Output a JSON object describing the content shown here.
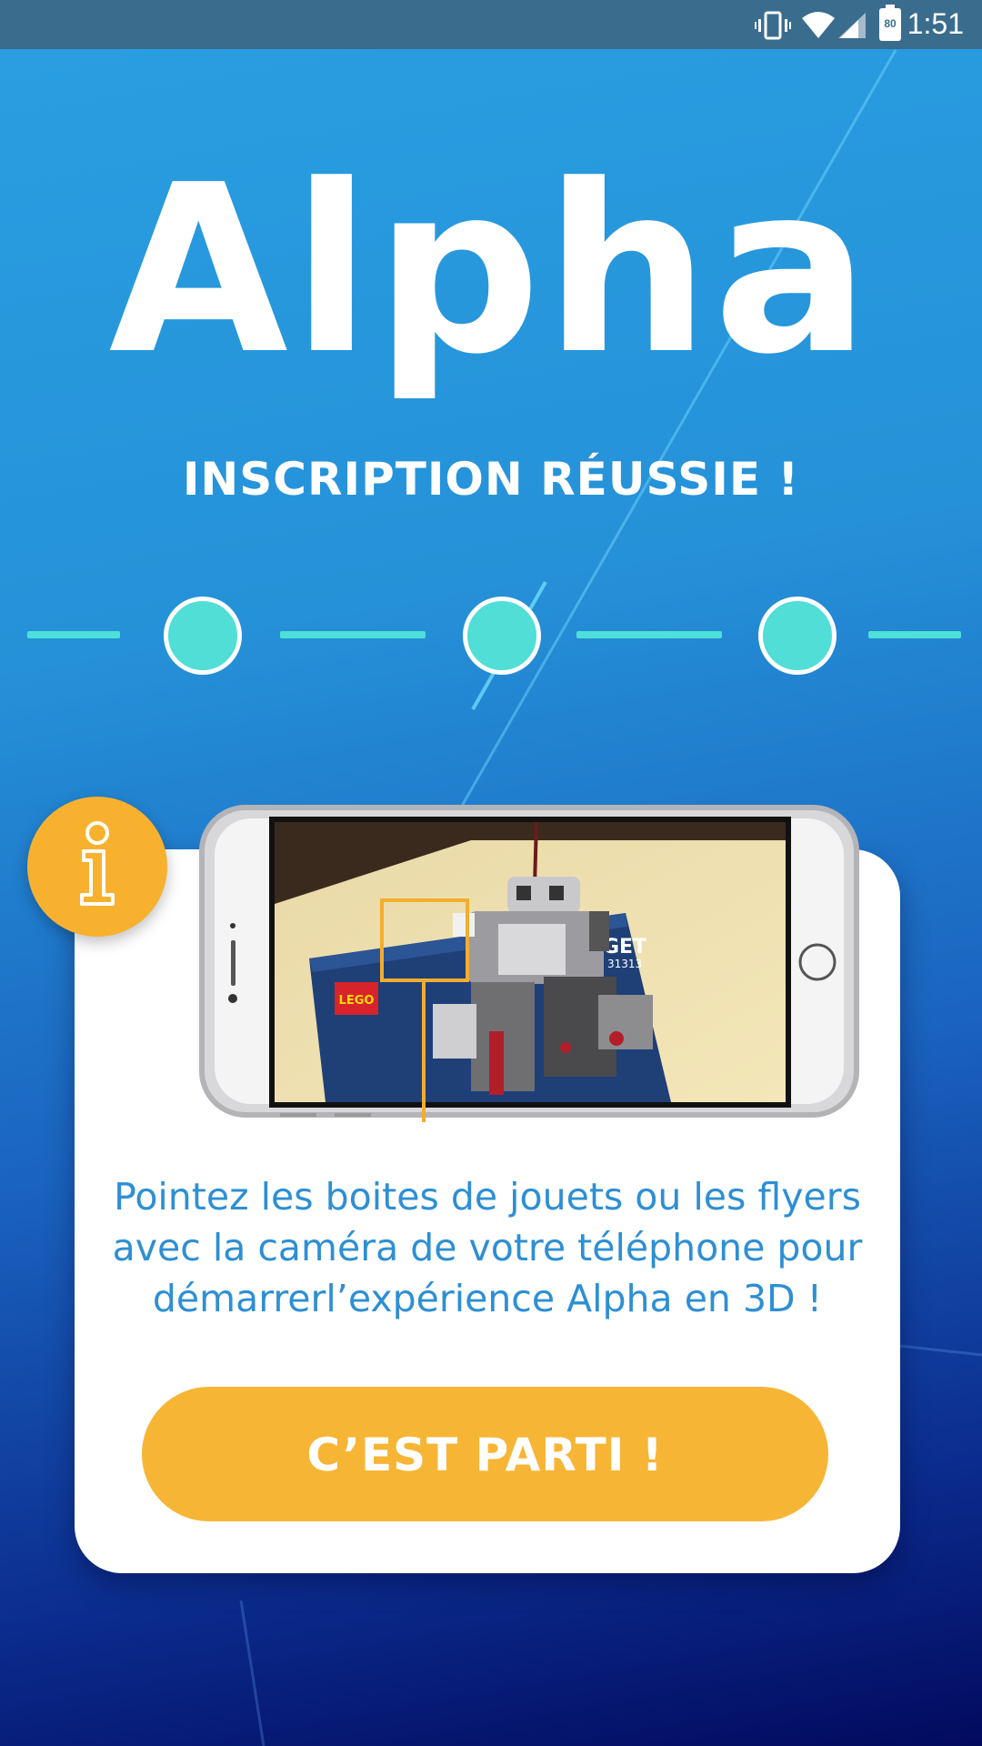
{
  "status_bar": {
    "time": "1:51",
    "battery_level": "80",
    "icons": [
      "vibrate-icon",
      "wifi-icon",
      "cell-signal-icon",
      "battery-icon"
    ]
  },
  "app": {
    "logo_text": "Alpha",
    "title": "INSCRIPTION RÉUSSIE !"
  },
  "stepper": {
    "steps": 3,
    "completed": 3,
    "color": "#50ded6"
  },
  "card": {
    "info_icon": "info-icon",
    "illustration": "phone-ar-robot-illustration",
    "description_lines": [
      "Pointez les boites de jouets ou les flyers",
      "avec la caméra de votre téléphone pour",
      "démarrerl’expérience Alpha en 3D !"
    ],
    "target_label": "RGET",
    "target_number": "31313",
    "brand_mark": "LEGO",
    "button_label": "C’EST PARTI !"
  },
  "colors": {
    "accent": "#f7b535",
    "teal": "#50ded6",
    "text_blue": "#2e8fd3",
    "status_bar": "#3a6c8e"
  }
}
